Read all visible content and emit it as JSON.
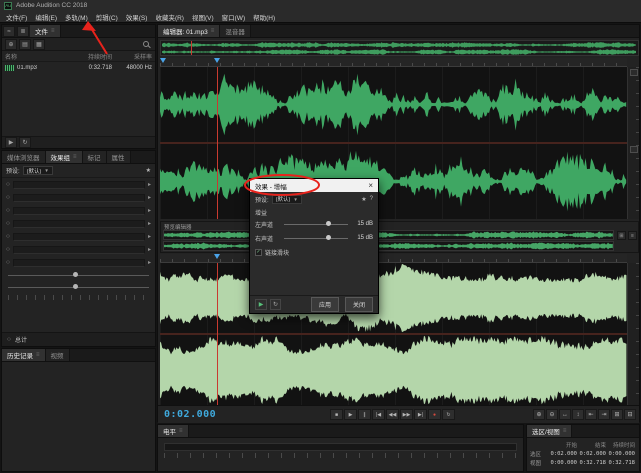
{
  "window": {
    "title": "Adobe Audition CC 2018",
    "app_icon": "Au"
  },
  "menu": {
    "items": [
      "文件(F)",
      "编辑(E)",
      "多轨(M)",
      "剪辑(C)",
      "效果(S)",
      "收藏夹(R)",
      "视图(V)",
      "窗口(W)",
      "帮助(H)"
    ]
  },
  "ui": {
    "panel_menu": "≡",
    "caret": "▼"
  },
  "view_toolbar": {
    "waveform_view_icon": "≈",
    "multitrack_view_icon": "≣"
  },
  "files_panel": {
    "tab": "文件",
    "toolbar_icons": {
      "import": "⊕",
      "folder": "▤",
      "media": "▦"
    },
    "columns": [
      "名称",
      "持续时间",
      "采样率"
    ],
    "file": {
      "name": "01.mp3",
      "duration": "0:32.718",
      "sample_rate": "48000 Hz"
    }
  },
  "rack_panel": {
    "tabs": [
      "媒体浏览器",
      "效果组",
      "标记",
      "属性"
    ],
    "preset_label": "预设:",
    "preset_value": "(默认)",
    "favorite_icon": "★",
    "slot_power": "○",
    "slot_arrow": "▸",
    "total_label": "总计"
  },
  "history_panel": {
    "tabs": [
      "历史记录",
      "视频"
    ]
  },
  "editor": {
    "tab": "编辑器: 01.mp3",
    "mixer_tab": "混音器",
    "preview_label": "预览编辑器",
    "timecode": "0:02.000"
  },
  "dialog": {
    "title": "效果 - 增幅",
    "close": "×",
    "preset_label": "预设:",
    "preset_value": "(默认)",
    "favorite_icon": "★",
    "help_icon": "?",
    "section": "增益",
    "sliders": [
      {
        "label": "左声道",
        "value": "15 dB"
      },
      {
        "label": "右声道",
        "value": "15 dB"
      }
    ],
    "link_checkbox": "链接滑块",
    "check": "✓",
    "play_icon": "▶",
    "loop_icon": "↻",
    "apply": "应用",
    "close_btn": "关闭"
  },
  "transport": {
    "glyphs": [
      "■",
      "▶",
      "∥",
      "|◀",
      "◀◀",
      "▶▶",
      "▶|",
      "●",
      "↻"
    ]
  },
  "zoom": {
    "glyphs": [
      "⊕",
      "⊖",
      "↔",
      "↕",
      "⇤",
      "⇥",
      "⊞",
      "⊟"
    ]
  },
  "levels_panel": {
    "tab": "电平"
  },
  "selection_panel": {
    "tab": "选区/视图",
    "headers": [
      "开始",
      "结束",
      "持续时间"
    ],
    "rows": [
      {
        "label": "选区",
        "start": "0:02.000",
        "end": "0:02.000",
        "duration": "0:00.000"
      },
      {
        "label": "视图",
        "start": "0:00.000",
        "end": "0:32.718",
        "duration": "0:32.718"
      }
    ]
  },
  "colors": {
    "waveform_green": "#3fa763",
    "preview_pale_green": "#b4d6aa",
    "playhead_red": "#c93a30",
    "annotation_red": "#e8231c",
    "timecode_blue": "#3fa9dc"
  }
}
